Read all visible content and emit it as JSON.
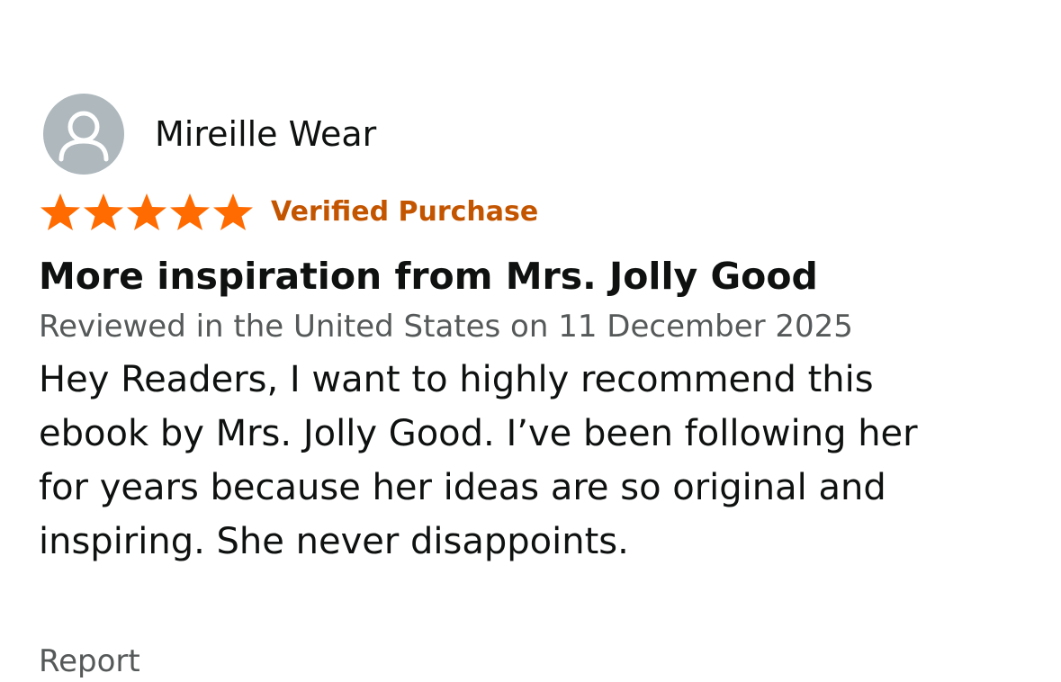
{
  "review": {
    "reviewer_name": "Mireille Wear",
    "rating": 5,
    "rating_max": 5,
    "verified_label": "Verified Purchase",
    "title": "More inspiration from Mrs. Jolly Good",
    "meta": "Reviewed in the United States on 11 December 2025",
    "body_lines": [
      "Hey Readers, I want to highly recommend this",
      "ebook by Mrs. Jolly Good. I’ve been following her",
      "for years because her ideas are so original and",
      "inspiring. She never disappoints."
    ],
    "report_label": "Report"
  },
  "colors": {
    "star": "#ff6b00",
    "verified": "#c45500",
    "meta_text": "#565959",
    "avatar_bg": "#aeb8bd"
  },
  "icons": {
    "avatar": "user-silhouette-icon",
    "star": "star-icon"
  }
}
